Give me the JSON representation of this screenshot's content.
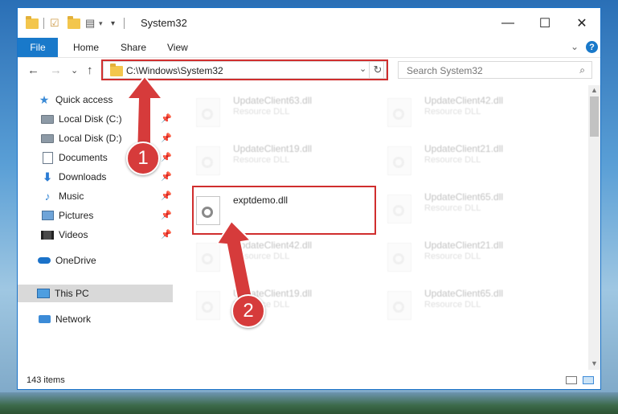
{
  "window": {
    "title": "System32",
    "controls": {
      "minimize": "—",
      "maximize": "☐",
      "close": "✕"
    }
  },
  "ribbon": {
    "tabs": [
      "File",
      "Home",
      "Share",
      "View"
    ],
    "expand_glyph": "⌄",
    "help_glyph": "?"
  },
  "navigation": {
    "back_glyph": "←",
    "forward_glyph": "→",
    "recent_glyph": "⌄",
    "up_glyph": "↑",
    "address_path": "C:\\Windows\\System32",
    "address_dropdown_glyph": "⌄",
    "refresh_glyph": "↻",
    "search_placeholder": "Search System32",
    "search_glyph": "⌕"
  },
  "sidebar": {
    "items": [
      {
        "label": "Quick access",
        "icon": "star-icon",
        "pinned": false
      },
      {
        "label": "Local Disk (C:)",
        "icon": "drive-icon",
        "pinned": true
      },
      {
        "label": "Local Disk (D:)",
        "icon": "drive-icon",
        "pinned": true
      },
      {
        "label": "Documents",
        "icon": "document-icon",
        "pinned": true
      },
      {
        "label": "Downloads",
        "icon": "download-icon",
        "pinned": true
      },
      {
        "label": "Music",
        "icon": "music-icon",
        "pinned": true
      },
      {
        "label": "Pictures",
        "icon": "pictures-icon",
        "pinned": true
      },
      {
        "label": "Videos",
        "icon": "videos-icon",
        "pinned": true
      },
      {
        "label": "OneDrive",
        "icon": "onedrive-icon",
        "pinned": false
      },
      {
        "label": "This PC",
        "icon": "this-pc-icon",
        "pinned": false,
        "selected": true
      },
      {
        "label": "Network",
        "icon": "network-icon",
        "pinned": false
      }
    ],
    "pin_glyph": "📌"
  },
  "files": [
    {
      "name": "UpdateClient63.dll",
      "type": "Resource DLL"
    },
    {
      "name": "UpdateClient42.dll",
      "type": "Resource DLL"
    },
    {
      "name": "UpdateClient19.dll",
      "type": "Resource DLL"
    },
    {
      "name": "UpdateClient21.dll",
      "type": "Resource DLL"
    },
    {
      "name": "exptdemo.dll",
      "type": ""
    },
    {
      "name": "UpdateClient65.dll",
      "type": "Resource DLL"
    },
    {
      "name": "UpdateClient42.dll",
      "type": "Resource DLL"
    },
    {
      "name": "UpdateClient21.dll",
      "type": "Resource DLL"
    },
    {
      "name": "UpdateClient19.dll",
      "type": "Resource DLL"
    },
    {
      "name": "UpdateClient65.dll",
      "type": "Resource DLL"
    }
  ],
  "status": {
    "item_count": "143 items"
  },
  "annotations": {
    "step1": "1",
    "step2": "2"
  },
  "colors": {
    "accent": "#1979ca",
    "callout": "#d02e2e",
    "badge": "#d63b3b"
  }
}
